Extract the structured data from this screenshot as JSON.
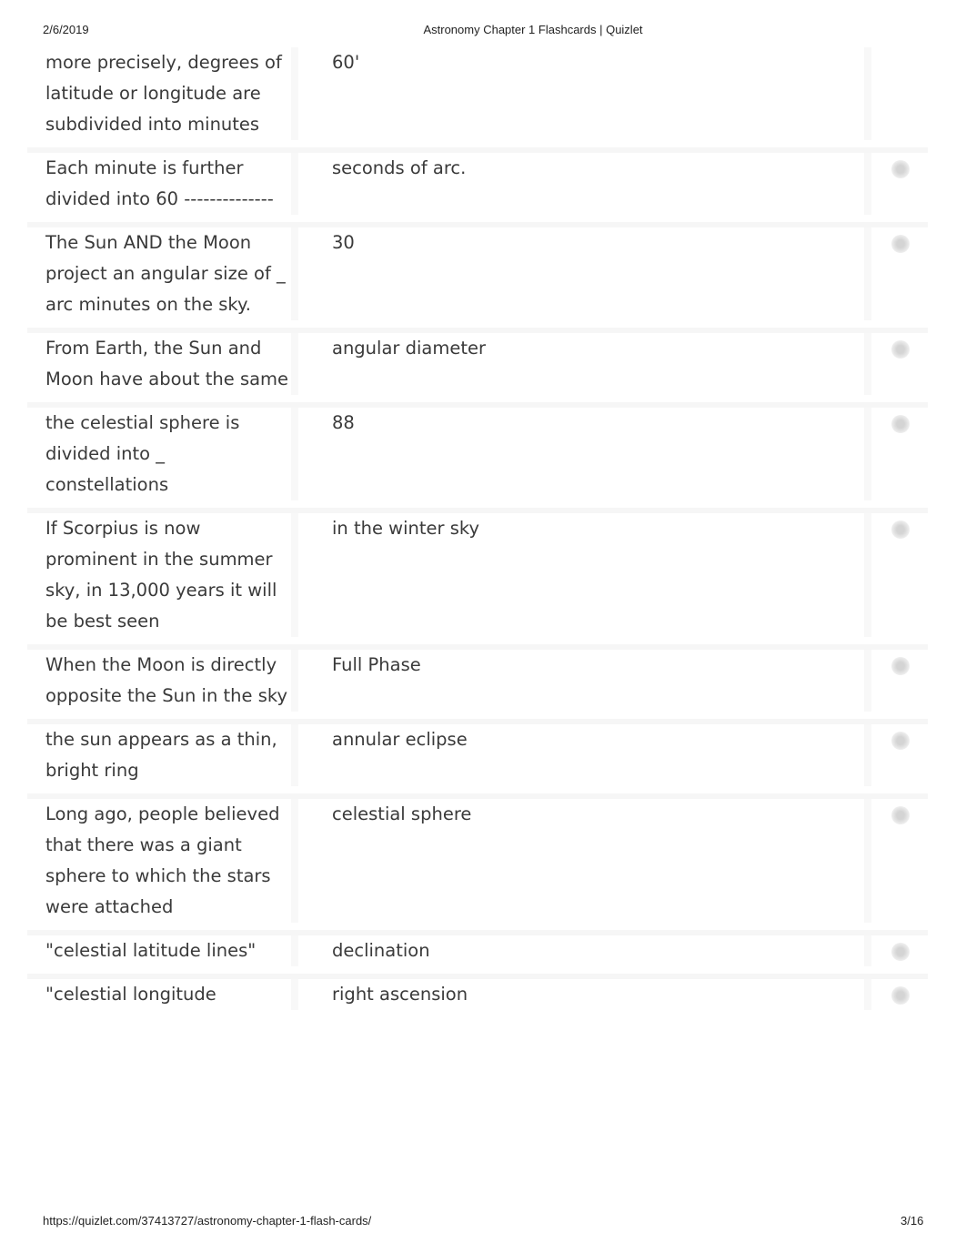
{
  "header": {
    "date": "2/6/2019",
    "title": "Astronomy Chapter 1 Flashcards | Quizlet"
  },
  "footer": {
    "url": "https://quizlet.com/37413727/astronomy-chapter-1-flash-cards/",
    "page": "3/16"
  },
  "cards": [
    {
      "term": "more precisely, degrees of latitude or longitude are subdivided into minutes",
      "definition": "60'"
    },
    {
      "term": "Each minute is further divided into 60 --------------",
      "definition": "seconds of arc."
    },
    {
      "term": "The Sun AND the Moon project an angular size of _ arc minutes on the sky.",
      "definition": "30"
    },
    {
      "term": "From Earth, the Sun and Moon have about the same",
      "definition": "angular diameter"
    },
    {
      "term": "the celestial sphere is divided into _ constellations",
      "definition": "88"
    },
    {
      "term": "If Scorpius is now prominent in the summer sky, in 13,000 years it will be best seen",
      "definition": "in the winter sky"
    },
    {
      "term": "When the Moon is directly opposite the Sun in the sky",
      "definition": "Full Phase"
    },
    {
      "term": "the sun appears as a thin, bright ring",
      "definition": "annular eclipse"
    },
    {
      "term": "Long ago, people believed that there was a giant sphere to which the stars were attached",
      "definition": "celestial sphere"
    },
    {
      "term": "\"celestial latitude lines\"",
      "definition": "declination"
    },
    {
      "term": "\"celestial longitude",
      "definition": "right ascension"
    }
  ],
  "icons": {
    "card_action": "star-icon"
  }
}
